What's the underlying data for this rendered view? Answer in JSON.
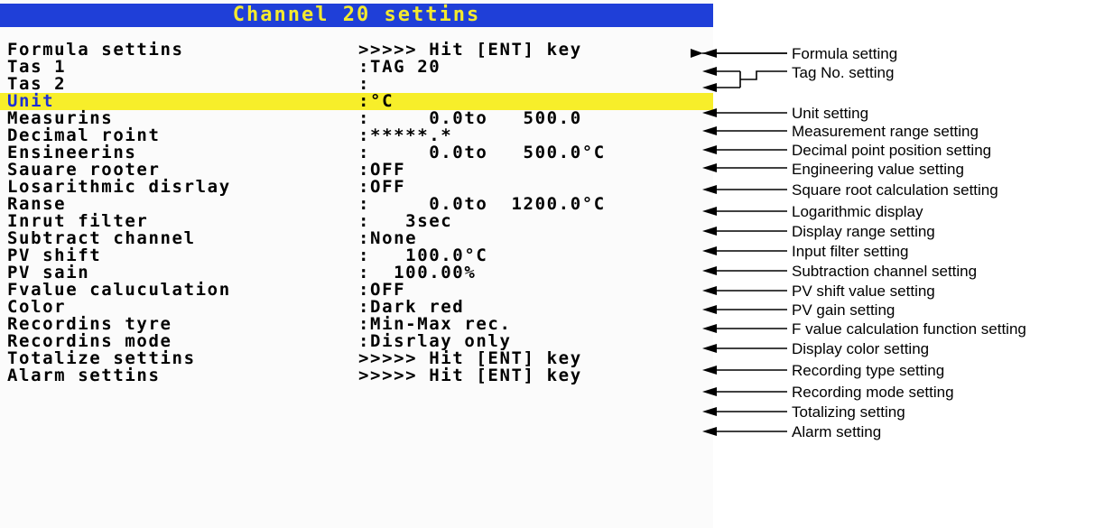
{
  "screen": {
    "title": "Channel 20 settins",
    "rows": [
      {
        "label": "Formula settins",
        "value": ">>>>> Hit [ENT] key"
      },
      {
        "label": "Tas 1",
        "value": ":TAG 20"
      },
      {
        "label": "Tas 2",
        "value": ":"
      },
      {
        "label": "Unit",
        "value": ":°C",
        "highlighted": true
      },
      {
        "label": "Measurins",
        "value": ":     0.0to   500.0"
      },
      {
        "label": "Decimal roint",
        "value": ":*****.*"
      },
      {
        "label": "Ensineerins",
        "value": ":     0.0to   500.0°C"
      },
      {
        "label": "Sauare rooter",
        "value": ":OFF"
      },
      {
        "label": "Losarithmic disrlay",
        "value": ":OFF"
      },
      {
        "label": "Ranse",
        "value": ":     0.0to  1200.0°C"
      },
      {
        "label": "Inrut filter",
        "value": ":   3sec"
      },
      {
        "label": "Subtract channel",
        "value": ":None"
      },
      {
        "label": "PV shift",
        "value": ":   100.0°C"
      },
      {
        "label": "PV sain",
        "value": ":  100.00%"
      },
      {
        "label": "Fvalue caluculation",
        "value": ":OFF"
      },
      {
        "label": "Color",
        "value": ":Dark red"
      },
      {
        "label": "Recordins tyre",
        "value": ":Min-Max rec."
      },
      {
        "label": "Recordins mode",
        "value": ":Disrlay only"
      },
      {
        "label": "Totalize settins",
        "value": ">>>>> Hit [ENT] key"
      },
      {
        "label": "Alarm settins",
        "value": ">>>>> Hit [ENT] key"
      }
    ]
  },
  "annotations": [
    "Formula setting",
    "Tag No. setting",
    "Unit setting",
    "Measurement range setting",
    "Decimal point position setting",
    "Engineering value setting",
    "Square root calculation setting",
    "Logarithmic display",
    "Display range setting",
    "Input filter setting",
    "Subtraction channel setting",
    "PV shift value setting",
    "PV gain setting",
    "F value calculation function setting",
    "Display color setting",
    "Recording type setting",
    "Recording mode setting",
    "Totalizing setting",
    "Alarm setting"
  ],
  "colors": {
    "title_bg": "#1f3fd8",
    "title_text": "#f4ea2e",
    "highlight_bg": "#f7ee2a",
    "highlight_text": "#1c2fd6",
    "text": "#000000"
  }
}
